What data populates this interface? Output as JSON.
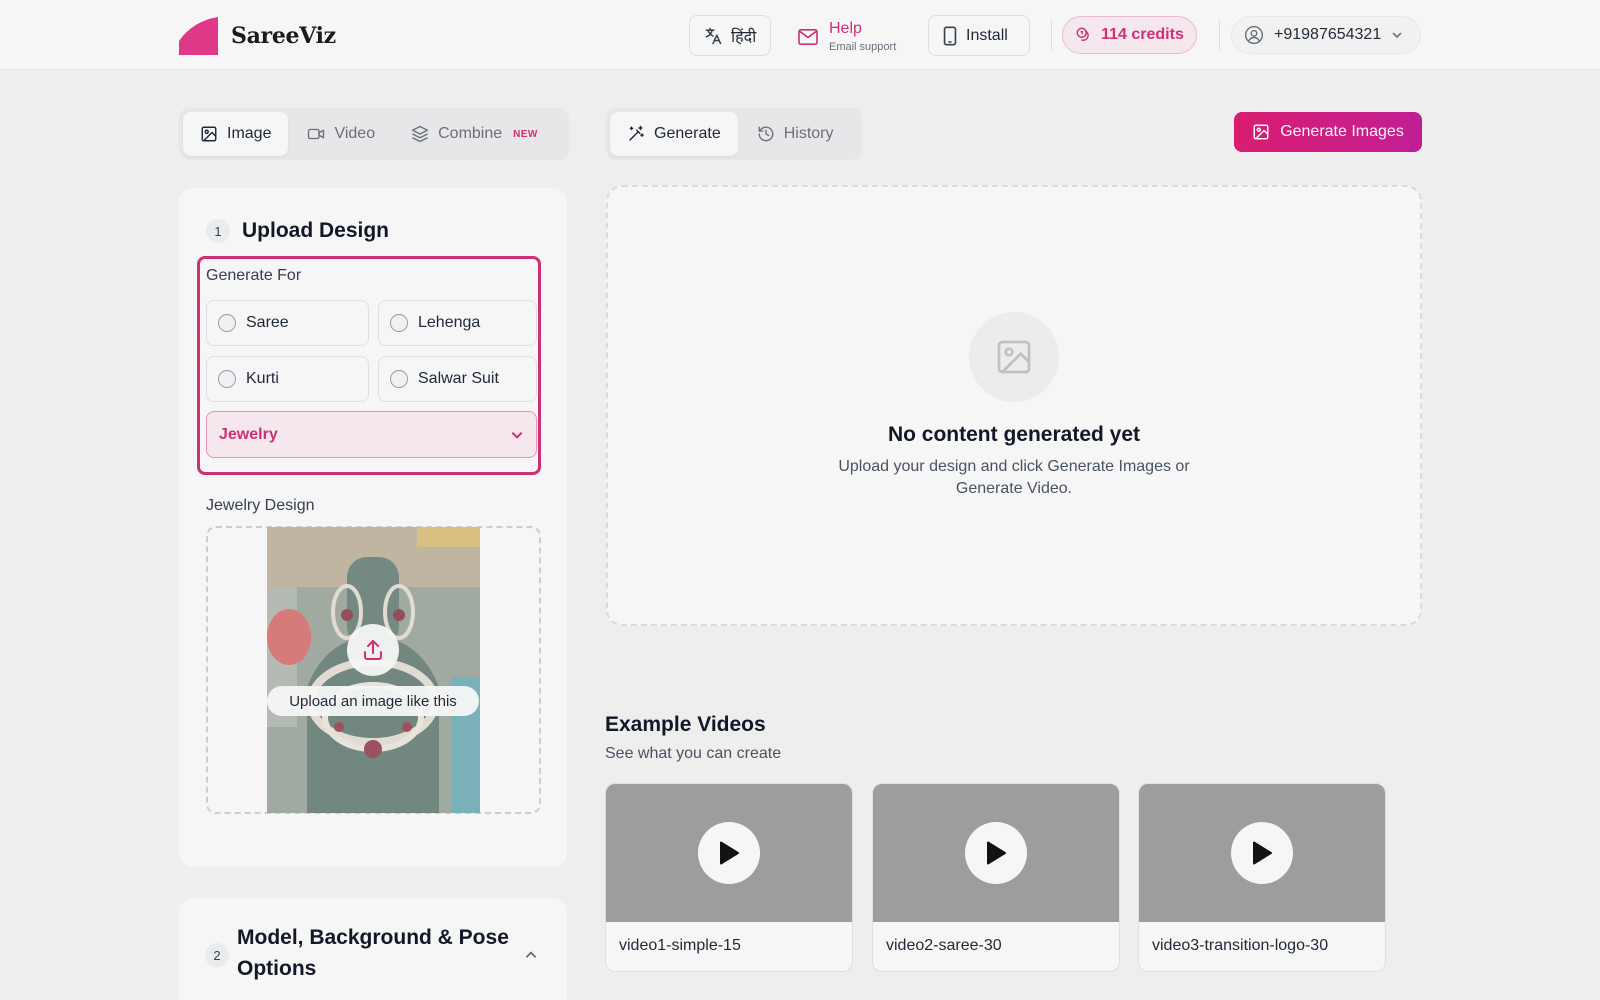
{
  "header": {
    "brand": "SareeViz",
    "language_label": "हिंदी",
    "help_title": "Help",
    "help_subtitle": "Email support",
    "install_label": "Install",
    "credits_label": "114 credits",
    "phone": "+91987654321"
  },
  "mode_tabs": [
    {
      "label": "Image",
      "active": true
    },
    {
      "label": "Video",
      "active": false
    },
    {
      "label": "Combine",
      "badge": "NEW",
      "active": false
    }
  ],
  "view_tabs": [
    {
      "label": "Generate",
      "active": true
    },
    {
      "label": "History",
      "active": false
    }
  ],
  "primary_action": {
    "label": "Generate Images"
  },
  "upload_section": {
    "step": "1",
    "title": "Upload Design",
    "generate_for_label": "Generate For",
    "options": [
      "Saree",
      "Lehenga",
      "Kurti",
      "Salwar Suit"
    ],
    "selected": "Jewelry",
    "design_label": "Jewelry Design",
    "upload_hint": "Upload an image like this"
  },
  "model_section": {
    "step": "2",
    "title": "Model, Background & Pose Options"
  },
  "output": {
    "empty_title": "No content generated yet",
    "empty_desc": "Upload your design and click Generate Images or Generate Video."
  },
  "examples": {
    "title": "Example Videos",
    "subtitle": "See what you can create",
    "videos": [
      {
        "name": "video1-simple-15"
      },
      {
        "name": "video2-saree-30"
      },
      {
        "name": "video3-transition-logo-30"
      }
    ]
  },
  "colors": {
    "accent": "#d6317a",
    "accent_bg": "#fdf0f6",
    "gradient_start": "#e11d74",
    "gradient_end": "#c81e9b"
  }
}
